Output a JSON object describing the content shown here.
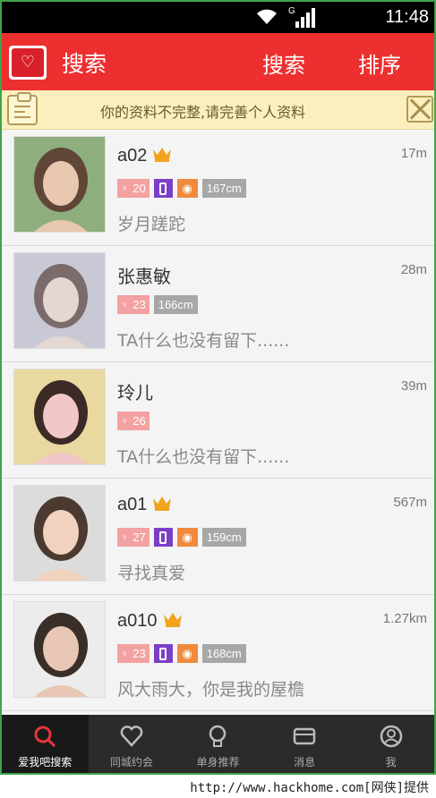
{
  "status": {
    "time": "11:48",
    "network": "G"
  },
  "appbar": {
    "logo_text": "♡",
    "title": "搜索",
    "search_label": "搜索",
    "sort_label": "排序"
  },
  "notice": {
    "text": "你的资料不完整,请完善个人资料"
  },
  "users": [
    {
      "name": "a02",
      "vip": true,
      "distance": "17m",
      "age": "20",
      "phone": true,
      "weibo": true,
      "height": "167cm",
      "signature": "岁月蹉跎",
      "photo_colors": [
        "#8fae7e",
        "#5f4637",
        "#e8c8b0"
      ]
    },
    {
      "name": "张惠敏",
      "vip": false,
      "distance": "28m",
      "age": "23",
      "phone": false,
      "weibo": false,
      "height": "166cm",
      "signature": "TA什么也没有留下......",
      "photo_colors": [
        "#c9c9d6",
        "#7c6b6b",
        "#e4d7d2"
      ]
    },
    {
      "name": "玲儿",
      "vip": false,
      "distance": "39m",
      "age": "26",
      "phone": false,
      "weibo": false,
      "height": "",
      "signature": "TA什么也没有留下......",
      "photo_colors": [
        "#e9d9a0",
        "#3b2a25",
        "#f2c7c7"
      ]
    },
    {
      "name": "a01",
      "vip": true,
      "distance": "567m",
      "age": "27",
      "phone": true,
      "weibo": true,
      "height": "159cm",
      "signature": "寻找真爱",
      "photo_colors": [
        "#dcdcdc",
        "#4a3a30",
        "#f0d2be"
      ]
    },
    {
      "name": "a010",
      "vip": true,
      "distance": "1.27km",
      "age": "23",
      "phone": true,
      "weibo": true,
      "height": "168cm",
      "signature": "风大雨大，你是我的屋檐",
      "photo_colors": [
        "#ececec",
        "#3a2e29",
        "#e8c7b4"
      ]
    }
  ],
  "tabs": [
    {
      "label": "爱我吧搜索",
      "icon": "search-icon",
      "active": true
    },
    {
      "label": "同城约会",
      "icon": "heart-icon",
      "active": false
    },
    {
      "label": "单身推荐",
      "icon": "lightbulb-icon",
      "active": false
    },
    {
      "label": "消息",
      "icon": "message-icon",
      "active": false
    },
    {
      "label": "我",
      "icon": "profile-icon",
      "active": false
    }
  ],
  "footer": {
    "watermark": "http://www.hackhome.com[网侠]提供"
  }
}
